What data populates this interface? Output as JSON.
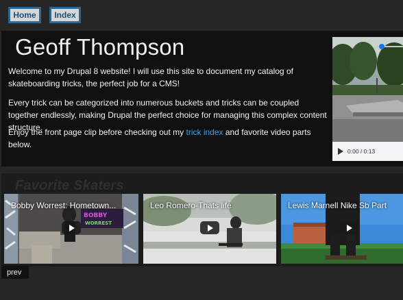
{
  "nav": {
    "home_label": "Home",
    "index_label": "Index"
  },
  "hero": {
    "title": "Geoff Thompson",
    "paragraph1": "Welcome to my Drupal 8 website! I will use this site to document my catalog of skateboarding tricks, the perfect job for a CMS!",
    "paragraph2": "Every trick can be categorized into numerous buckets and tricks can be coupled together endlessly, making Drupal the perfect choice for managing this complex content structure.",
    "paragraph3_before": "Enjoy the front page clip before checking out my ",
    "paragraph3_link": "trick index",
    "paragraph3_after": " and favorite video parts below."
  },
  "video_player": {
    "time": "0:00 / 0:13"
  },
  "favorites": {
    "title": "Favorite Skaters",
    "videos": [
      {
        "title": "Bobby Worrest: Hometown..."
      },
      {
        "title": "Leo Romero-Thats life"
      },
      {
        "title": "Lewis Marnell Nike Sb Part"
      }
    ],
    "prev_label": "prev"
  },
  "colors": {
    "nav_border": "#2d6790",
    "link": "#3ea1e6",
    "background": "#262626"
  }
}
